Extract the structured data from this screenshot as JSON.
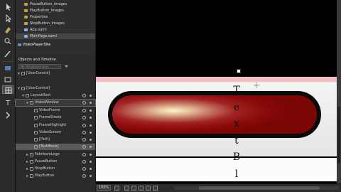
{
  "projects": {
    "items": [
      {
        "label": "PauseButton_Images",
        "kind": "folder"
      },
      {
        "label": "PlayButton_Images",
        "kind": "folder"
      },
      {
        "label": "Properties",
        "kind": "folder"
      },
      {
        "label": "StopButton_Images",
        "kind": "folder"
      },
      {
        "label": "App.xaml",
        "kind": "file"
      },
      {
        "label": "MainPage.xaml",
        "kind": "file"
      },
      {
        "label": "VideoPlayerSite",
        "kind": "project"
      }
    ]
  },
  "objects_panel": {
    "title": "Objects and Timeline",
    "search_placeholder": "No storyboard open",
    "tree": [
      {
        "label": "[UserControl]",
        "expanded": true
      },
      {
        "label": "[UserControl]",
        "expanded": true
      },
      {
        "label": "LayoutRoot",
        "expanded": true
      },
      {
        "label": "VideoWindow",
        "expanded": true
      },
      {
        "label": "VideoFrame"
      },
      {
        "label": "FrameStroke"
      },
      {
        "label": "FrameHighlight"
      },
      {
        "label": "VideoScreen"
      },
      {
        "label": "[Path]"
      },
      {
        "label": "[TextBlock]"
      },
      {
        "label": "FabrikamLogo"
      },
      {
        "label": "PauseButton"
      },
      {
        "label": "StopButton"
      },
      {
        "label": "PlayButton"
      }
    ]
  },
  "artboard": {
    "text_letters": [
      "T",
      "e",
      "x",
      "t",
      "B",
      "l"
    ]
  },
  "status_bar": {
    "zoom": "100%"
  },
  "colors": {
    "pill_red": "#8c0b0b",
    "pill_highlight": "#f6f4d2",
    "panel_bg": "#2b2b2b"
  }
}
